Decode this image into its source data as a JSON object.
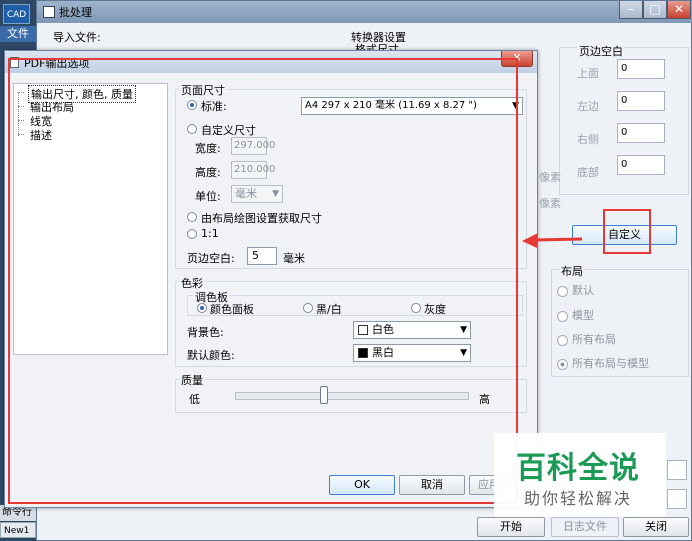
{
  "app": {
    "logo": "CAD",
    "menu_label": "文件",
    "command_label": "命令行",
    "tab_label": "New1"
  },
  "batch_window": {
    "title": "批处理",
    "import_label": "导入文件:",
    "converter_label": "转换器设置",
    "format_label": "格式尺寸",
    "margin_group": {
      "label": "页边空白",
      "top_label": "上面",
      "top_value": "0",
      "left_label": "左边",
      "left_value": "0",
      "right_label": "右侧",
      "right_value": "0",
      "bottom_label": "底部",
      "bottom_value": "0"
    },
    "pixels_text": "像素",
    "customize_button": "自定义",
    "layout_group": {
      "label": "布局",
      "options": [
        "默认",
        "模型",
        "所有布局",
        "所有布局与模型"
      ],
      "selected": "所有布局与模型"
    },
    "start_button": "开始",
    "log_button": "日志文件",
    "close_button": "关闭"
  },
  "dialog": {
    "title": "PDF输出选项",
    "close_glyph": "✕",
    "tree_items": [
      "输出尺寸, 颜色, 质量",
      "输出布局",
      "线宽",
      "描述"
    ],
    "page_size": {
      "label": "页面尺寸",
      "standard_label": "标准:",
      "standard_value": "A4 297 x 210 毫米 (11.69 x 8.27 \")",
      "custom_label": "自定义尺寸",
      "width_label": "宽度:",
      "width_value": "297.000",
      "height_label": "高度:",
      "height_value": "210.000",
      "unit_label": "单位:",
      "unit_value": "毫米",
      "from_layout_label": "由布局绘图设置获取尺寸",
      "one_to_one_label": "1:1",
      "margin_label": "页边空白:",
      "margin_value": "5",
      "margin_unit": "毫米"
    },
    "color": {
      "label": "色彩",
      "palette_label": "调色板",
      "palette_options": [
        "颜色面板",
        "黑/白",
        "灰度"
      ],
      "palette_selected": "颜色面板",
      "background_label": "背景色:",
      "background_value": "白色",
      "background_swatch": "#ffffff",
      "default_label": "默认颜色:",
      "default_value": "黑白",
      "default_swatch": "#000000"
    },
    "quality": {
      "label": "质量",
      "low_label": "低",
      "high_label": "高",
      "level_fraction": 0.38
    },
    "ok_button": "OK",
    "cancel_button": "取消",
    "apply_button": "应用"
  },
  "watermark": {
    "title": "百科全说",
    "subtitle": "助你轻松解决"
  },
  "colors": {
    "highlight_red": "#e53935",
    "watermark_green": "#1c9b57",
    "accent_blue": "#3c7fd6"
  }
}
